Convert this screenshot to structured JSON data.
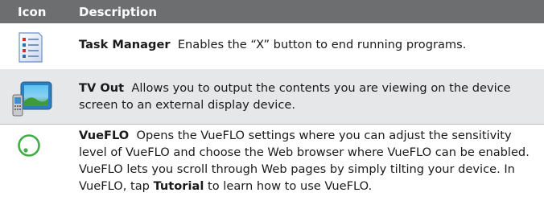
{
  "header": {
    "icon_label": "Icon",
    "description_label": "Description"
  },
  "rows": [
    {
      "icon": "task-manager-icon",
      "title": "Task Manager",
      "text": "Enables the “X” button to end running programs."
    },
    {
      "icon": "tv-out-icon",
      "title": "TV Out",
      "text": "Allows you to output the contents you are viewing on the device screen to an external display device."
    },
    {
      "icon": "vueflo-icon",
      "title": "VueFLO",
      "text_before": "Opens the VueFLO settings where you can adjust the sensitivity level of VueFLO and choose the Web browser where VueFLO can be enabled. VueFLO lets you scroll through Web pages by simply tilting your device.  In VueFLO, tap",
      "bold_word": "Tutorial",
      "text_after": "to learn how to use VueFLO."
    }
  ],
  "colors": {
    "header_bg": "#6d6e70",
    "shaded_row_bg": "#e6e7e8",
    "vueflo_green": "#3fae49",
    "tv_blue": "#2a7fc1"
  }
}
